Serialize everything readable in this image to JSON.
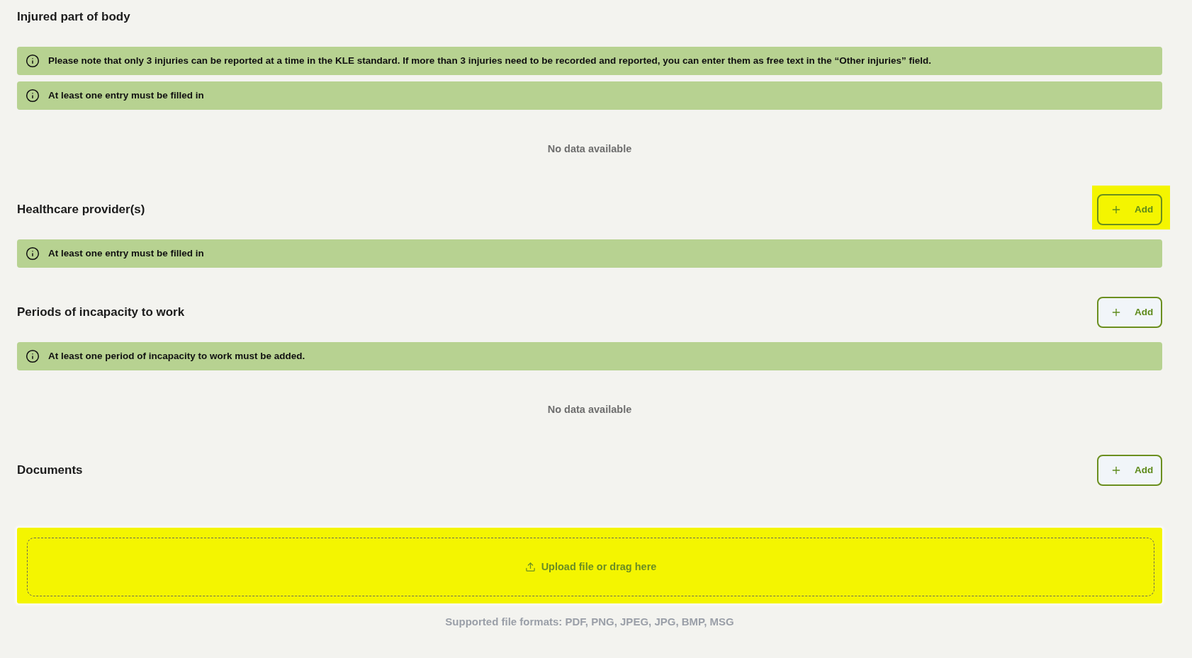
{
  "sections": [
    {
      "title": "Injured part of body",
      "notices": [
        "Please note that only 3 injuries can be reported at a time in the KLE standard. If more than 3 injuries need to be recorded and reported, you can enter them as free text in the “Other injuries” field.",
        "At least one entry must be filled in"
      ],
      "empty_text": "No data available"
    },
    {
      "title": "Healthcare provider(s)",
      "add_button": {
        "label": "Add",
        "highlighted": true
      },
      "notices": [
        "At least one entry must be filled in"
      ]
    },
    {
      "title": "Periods of incapacity to work",
      "add_button": {
        "label": "Add",
        "highlighted": false
      },
      "notices": [
        "At least one period of incapacity to work must be added."
      ],
      "empty_text": "No data available"
    },
    {
      "title": "Documents",
      "add_button": {
        "label": "Add",
        "highlighted": false
      },
      "upload": {
        "label": "Upload file or drag here",
        "highlighted": true,
        "formats": "Supported file formats: PDF, PNG, JPEG, JPG, BMP, MSG"
      }
    }
  ]
}
